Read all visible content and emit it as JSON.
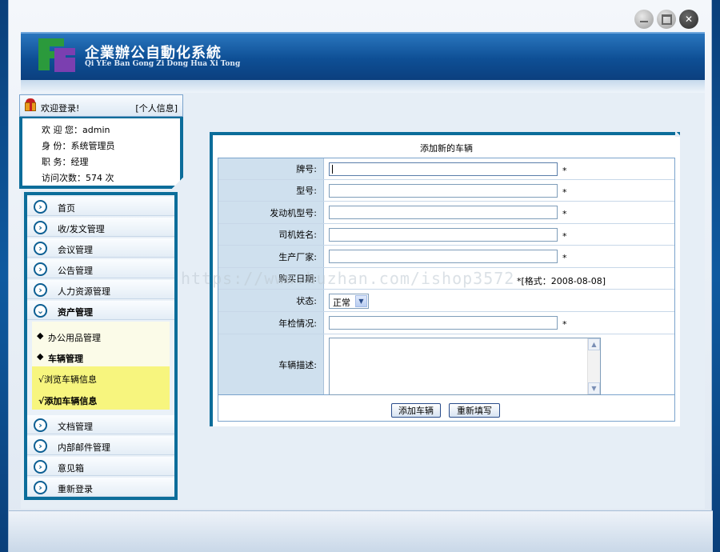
{
  "window": {
    "min_label": "",
    "max_label": "",
    "close_label": "✕"
  },
  "app": {
    "title": "企業辦公自動化系統",
    "subtitle": "Qi YEe Ban Gong Zi Dong Hua Xi Tong"
  },
  "sidebar": {
    "welcome": "欢迎登录!",
    "profile_link": "[个人信息]",
    "user": {
      "greeting_label": "欢 迎 您：",
      "greeting_value": "admin",
      "identity_label": "身    份：",
      "identity_value": "系统管理员",
      "position_label": "职    务：",
      "position_value": "经理",
      "visits_label": "访问次数：",
      "visits_value": "574 次"
    },
    "nav": [
      {
        "label": "首页"
      },
      {
        "label": "收/发文管理"
      },
      {
        "label": "会议管理"
      },
      {
        "label": "公告管理"
      },
      {
        "label": "人力资源管理"
      },
      {
        "label": "资产管理"
      }
    ],
    "asset_sub": {
      "office": "办公用品管理",
      "vehicle": "车辆管理",
      "browse": "√浏览车辆信息",
      "add": "√添加车辆信息"
    },
    "nav_after": [
      {
        "label": "文档管理"
      },
      {
        "label": "内部邮件管理"
      },
      {
        "label": "意见箱"
      },
      {
        "label": "重新登录"
      }
    ]
  },
  "form": {
    "title": "添加新的车辆",
    "fields": {
      "plate": "牌号:",
      "model": "型号:",
      "engine": "发动机型号:",
      "driver": "司机姓名:",
      "maker": "生产厂家:",
      "purchase_date": "购买日期:",
      "status": "状态:",
      "inspection": "年检情况:",
      "description": "车辆描述:"
    },
    "required_mark": "*",
    "date_hint": "*[格式：2008-08-08]",
    "status_selected": "正常",
    "submit": "添加车辆",
    "reset": "重新填写"
  },
  "watermark": "https://www.huzhan.com/ishop3572"
}
